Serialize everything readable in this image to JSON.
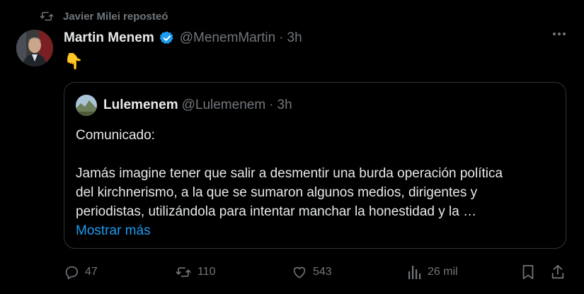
{
  "repost": {
    "text": "Javier Milei reposteó"
  },
  "tweet": {
    "author_name": "Martin Menem",
    "handle": "@MenemMartin",
    "separator": "·",
    "time": "3h",
    "text": "👇"
  },
  "quote": {
    "author_name": "Lulemenem",
    "handle": "@Lulemenem",
    "separator": "·",
    "time": "3h",
    "line1": "Comunicado:",
    "line2": "Jamás imagine tener que salir a desmentir una burda operación política",
    "line3": "del kirchnerismo, a la que se sumaron algunos medios, dirigentes y",
    "line4": "periodistas, utilizándola para intentar manchar la honestidad y la …",
    "show_more": "Mostrar más"
  },
  "actions": {
    "replies": "47",
    "reposts": "110",
    "likes": "543",
    "views": "26 mil"
  },
  "colors": {
    "background": "#000000",
    "text": "#e7e9ea",
    "muted": "#71767b",
    "link": "#1d9bf0",
    "verified": "#1d9bf0",
    "border": "#2f3336"
  }
}
